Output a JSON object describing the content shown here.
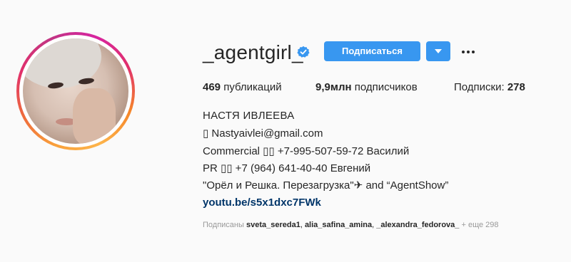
{
  "profile": {
    "username": "_agentgirl_",
    "verified_icon": "verified-badge-icon",
    "follow_label": "Подписаться",
    "dropdown_icon": "chevron-down-icon",
    "more_icon": "more-options-icon",
    "accent_color": "#3897f0"
  },
  "stats": {
    "posts_value": "469",
    "posts_label": "публикаций",
    "followers_value": "9,9млн",
    "followers_label": "подписчиков",
    "following_label": "Подписки:",
    "following_value": "278"
  },
  "bio": {
    "name": "НАСТЯ ИВЛЕЕВА",
    "email_line": "▯ Nastyaivlei@gmail.com",
    "commercial_line": "Commercial ▯▯ +7-995-507-59-72 Василий",
    "pr_line": "PR ▯▯ +7 (964) 641-40-40 Евгений",
    "shows_line": "\"Орёл и Решка. Перезагрузка\"✈ and “AgentShow”",
    "link": "youtu.be/s5x1dxc7FWk"
  },
  "followed_by": {
    "prefix": "Подписаны",
    "users": [
      "sveta_sereda1",
      "alia_safina_amina",
      "_alexandra_fedorova_"
    ],
    "more": "+ еще 298"
  }
}
